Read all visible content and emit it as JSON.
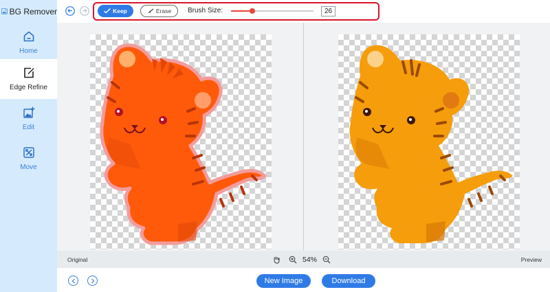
{
  "app": {
    "title": "BG Remover"
  },
  "sidebar": {
    "items": [
      {
        "label": "Home",
        "icon": "home-icon"
      },
      {
        "label": "Edge Refine",
        "icon": "edge-refine-icon",
        "active": true
      },
      {
        "label": "Edit",
        "icon": "edit-image-icon"
      },
      {
        "label": "Move",
        "icon": "move-icon"
      }
    ]
  },
  "toolbar": {
    "keep_label": "Keep",
    "erase_label": "Erase",
    "brush_label": "Brush Size:",
    "brush_value": "26",
    "brush_fraction": 0.26
  },
  "statusbar": {
    "original_label": "Original",
    "preview_label": "Preview",
    "zoom": "54%"
  },
  "bottombar": {
    "new_image_label": "New Image",
    "download_label": "Download"
  },
  "colors": {
    "accent": "#2f7be6",
    "highlight_frame": "#d9142a",
    "sidebar_bg": "#d5ebfd",
    "slider": "#e8463c",
    "tiger_original": "#ff5a0a",
    "tiger_preview": "#f59d0b"
  }
}
